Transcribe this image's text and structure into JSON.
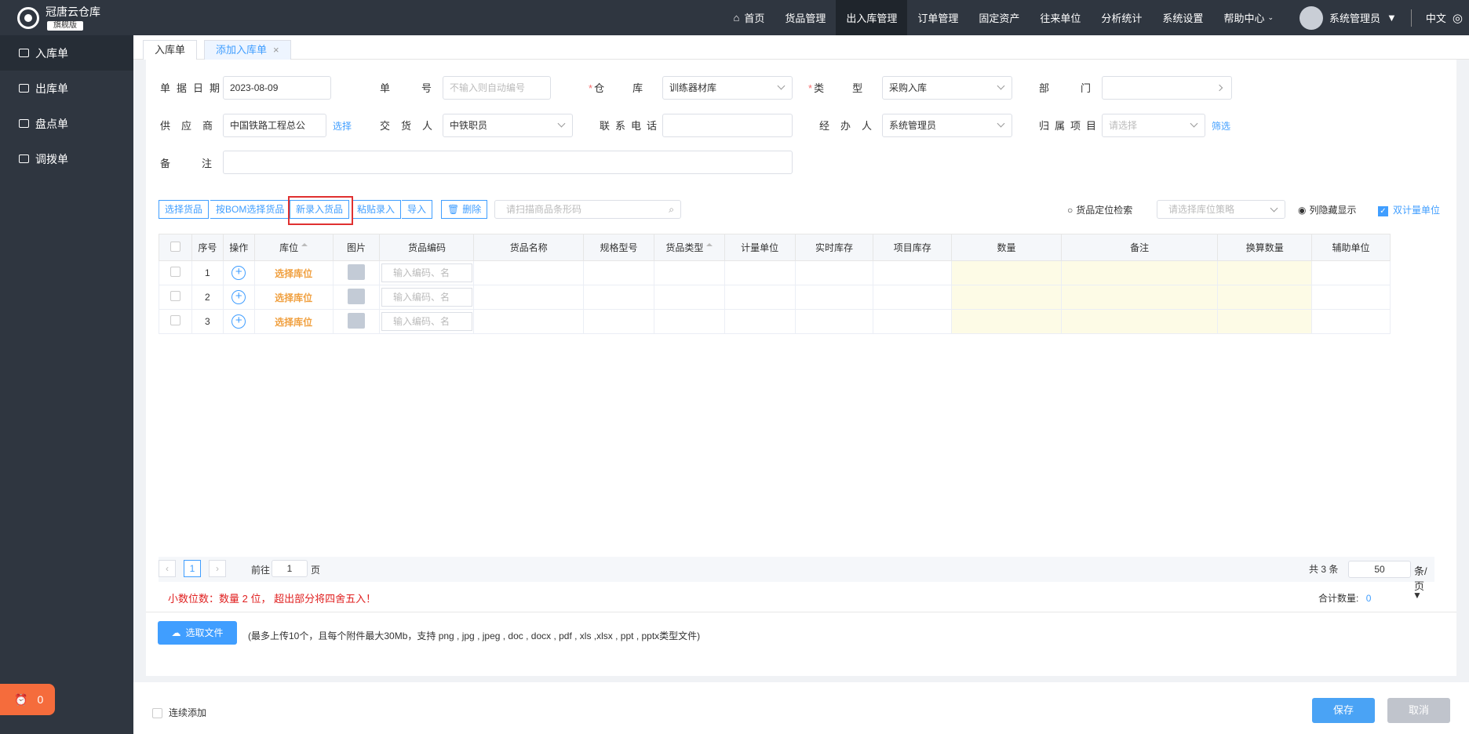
{
  "app": {
    "name": "冠唐云仓库",
    "edition": "旗舰版"
  },
  "sidebar": {
    "items": [
      {
        "label": "入库单"
      },
      {
        "label": "出库单"
      },
      {
        "label": "盘点单"
      },
      {
        "label": "调拨单"
      }
    ],
    "badge_count": "0"
  },
  "topnav": {
    "items": [
      "首页",
      "货品管理",
      "出入库管理",
      "订单管理",
      "固定资产",
      "往来单位",
      "分析统计",
      "系统设置",
      "帮助中心"
    ],
    "user": "系统管理员",
    "lang": "中文"
  },
  "tabs": [
    "入库单",
    "添加入库单"
  ],
  "form": {
    "date_label": "单据日期",
    "date_value": "2023-08-09",
    "no_label": "单号",
    "no_placeholder": "不输入则自动编号",
    "warehouse_label": "仓库",
    "warehouse_value": "训练器材库",
    "type_label": "类型",
    "type_value": "采购入库",
    "dept_label": "部门",
    "supplier_label": "供应商",
    "supplier_value": "中国铁路工程总公",
    "supplier_link": "选择",
    "deliverer_label": "交货人",
    "deliverer_value": "中铁职员",
    "phone_label": "联系电话",
    "handler_label": "经办人",
    "handler_value": "系统管理员",
    "project_label": "归属项目",
    "project_placeholder": "请选择",
    "project_link": "筛选",
    "remark_label": "备注"
  },
  "toolbar": {
    "select_goods": "选择货品",
    "bom_select": "按BOM选择货品",
    "new_goods": "新录入货品",
    "paste": "粘贴录入",
    "import": "导入",
    "delete": "删除",
    "scan_placeholder": "请扫描商品条形码",
    "locate": "货品定位检索",
    "loc_strategy_placeholder": "请选择库位策略",
    "hide_cols": "列隐藏显示",
    "dual_unit": "双计量单位"
  },
  "table": {
    "headers": [
      "序号",
      "操作",
      "库位",
      "图片",
      "货品编码",
      "货品名称",
      "规格型号",
      "货品类型",
      "计量单位",
      "实时库存",
      "项目库存",
      "数量",
      "备注",
      "换算数量",
      "辅助单位"
    ],
    "rows": [
      {
        "no": "1",
        "loc": "选择库位",
        "code_ph": "输入编码、名"
      },
      {
        "no": "2",
        "loc": "选择库位",
        "code_ph": "输入编码、名"
      },
      {
        "no": "3",
        "loc": "选择库位",
        "code_ph": "输入编码、名"
      }
    ]
  },
  "pager": {
    "current": "1",
    "goto_prefix": "前往",
    "goto_value": "1",
    "goto_suffix": "页",
    "total": "共 3 条",
    "page_size": "50",
    "page_size_suffix": "条/页"
  },
  "notice": "小数位数：数量 2 位， 超出部分将四舍五入！",
  "sum_label": "合计数量:",
  "sum_value": "0",
  "upload": {
    "button": "选取文件",
    "hint": "(最多上传10个，且每个附件最大30Mb，支持 png , jpg , jpeg , doc , docx , pdf , xls ,xlsx , ppt , pptx类型文件)"
  },
  "footer": {
    "continue_add": "连续添加",
    "save": "保存",
    "cancel": "取消"
  }
}
